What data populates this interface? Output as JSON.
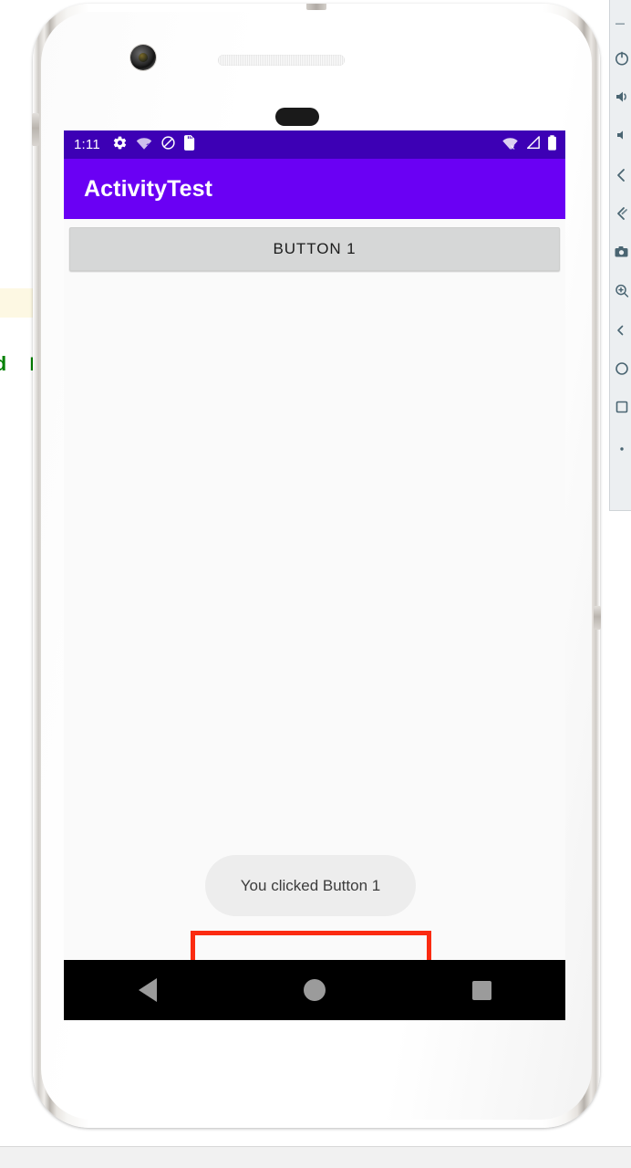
{
  "device": {
    "frame_color": "#ffffff",
    "camera_icon": "camera-lens",
    "speaker_icon": "earpiece-speaker"
  },
  "ide_background": {
    "code_fragment": "d B",
    "code_color": "#008000",
    "highlight_color": "#fdf8e3"
  },
  "status_bar": {
    "clock": "1:11",
    "background": "#3d00b5",
    "left_icons": [
      "settings-gear-icon",
      "wifi-question-icon",
      "do-not-disturb-icon",
      "sd-card-icon"
    ],
    "right_icons": [
      "wifi-off-icon",
      "cellular-signal-icon",
      "battery-full-icon"
    ]
  },
  "app_bar": {
    "title": "ActivityTest",
    "background": "#6a00f4",
    "text_color": "#ffffff"
  },
  "content": {
    "button1_label": "BUTTON 1",
    "button1_background": "#d6d7d7",
    "background": "#fafafa"
  },
  "toast": {
    "message": "You clicked Button 1",
    "background": "#ededed",
    "text_color": "#3c3c3c"
  },
  "annotation": {
    "color": "#fb2b11",
    "shape": "rectangle"
  },
  "nav_bar": {
    "background": "#000000",
    "items": [
      "back-triangle-icon",
      "home-circle-icon",
      "recents-square-icon"
    ],
    "icon_color": "#9b9b9b"
  },
  "emulator_toolbar": {
    "background": "#eceff1",
    "icon_color": "#4a6572",
    "items": [
      {
        "name": "minimize-icon"
      },
      {
        "name": "power-icon"
      },
      {
        "name": "volume-up-icon"
      },
      {
        "name": "volume-down-icon"
      },
      {
        "name": "rotate-left-icon"
      },
      {
        "name": "rotate-right-icon"
      },
      {
        "name": "screenshot-camera-icon"
      },
      {
        "name": "zoom-icon"
      },
      {
        "name": "back-icon"
      },
      {
        "name": "home-icon"
      },
      {
        "name": "overview-icon"
      },
      {
        "name": "more-options-icon"
      }
    ]
  }
}
